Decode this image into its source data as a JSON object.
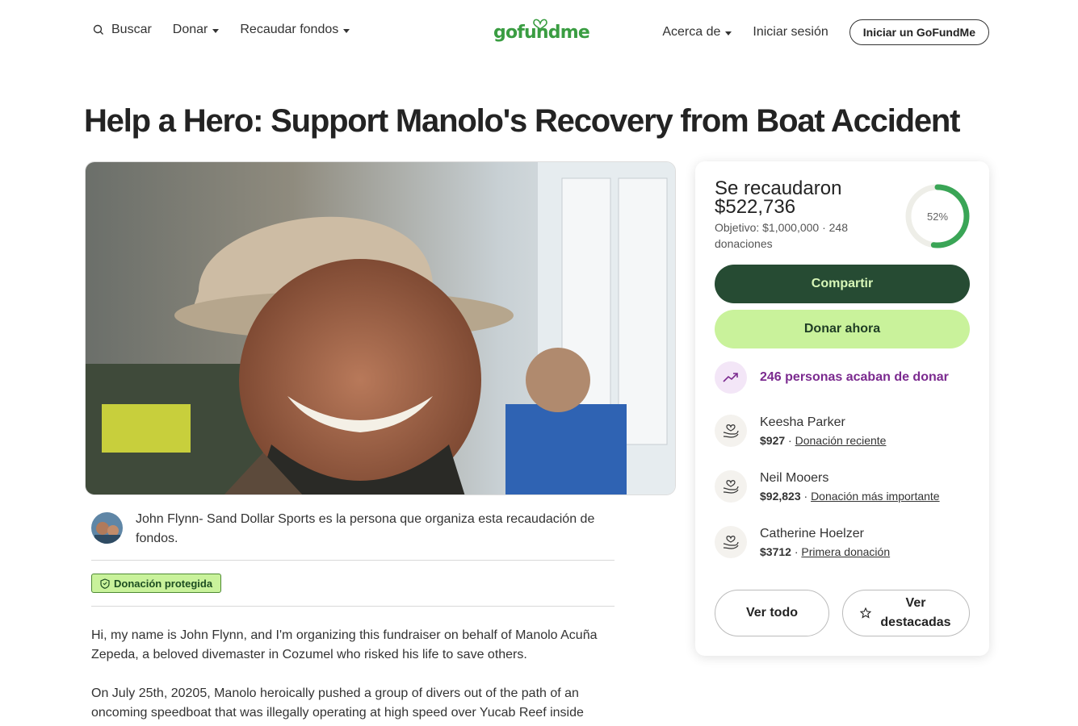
{
  "header": {
    "search_label": "Buscar",
    "donate_label": "Donar",
    "fundraise_label": "Recaudar fondos",
    "logo_text": "gofundme",
    "about_label": "Acerca de",
    "signin_label": "Iniciar sesión",
    "start_label": "Iniciar un GoFundMe"
  },
  "campaign": {
    "title": "Help a Hero: Support Manolo's Recovery from Boat Accident",
    "organizer_text": "John Flynn- Sand Dollar Sports es la persona que organiza esta recaudación de fondos.",
    "protected_label": "Donación protegida",
    "story": [
      "Hi, my name is John Flynn, and I'm organizing this fundraiser on behalf of Manolo Acuña Zepeda, a beloved divemaster in Cozumel who risked his life to save others.",
      "On July 25th, 20205, Manolo heroically pushed a group of divers out of the path of an oncoming speedboat that was illegally operating at high speed over Yucab Reef inside"
    ]
  },
  "sidebar": {
    "raised_label": "Se recaudaron",
    "raised_amount": "$522,736",
    "goal_text": "Objetivo: $1,000,000  ·  248 donaciones",
    "progress_percent": 52,
    "progress_label": "52%",
    "share_label": "Compartir",
    "donate_now_label": "Donar ahora",
    "recent_text": "246 personas acaban de donar",
    "donors": [
      {
        "name": "Keesha Parker",
        "amount": "$927",
        "tag": "Donación reciente"
      },
      {
        "name": "Neil Mooers",
        "amount": "$92,823",
        "tag": "Donación más importante"
      },
      {
        "name": "Catherine Hoelzer",
        "amount": "$3712",
        "tag": "Primera donación"
      }
    ],
    "see_all_label": "Ver todo",
    "featured_label": "Ver destacadas"
  },
  "colors": {
    "brand_green": "#3a9d42",
    "share_bg": "#264b33",
    "donate_bg": "#c9f29b",
    "recent_purple": "#7b2a8f"
  }
}
